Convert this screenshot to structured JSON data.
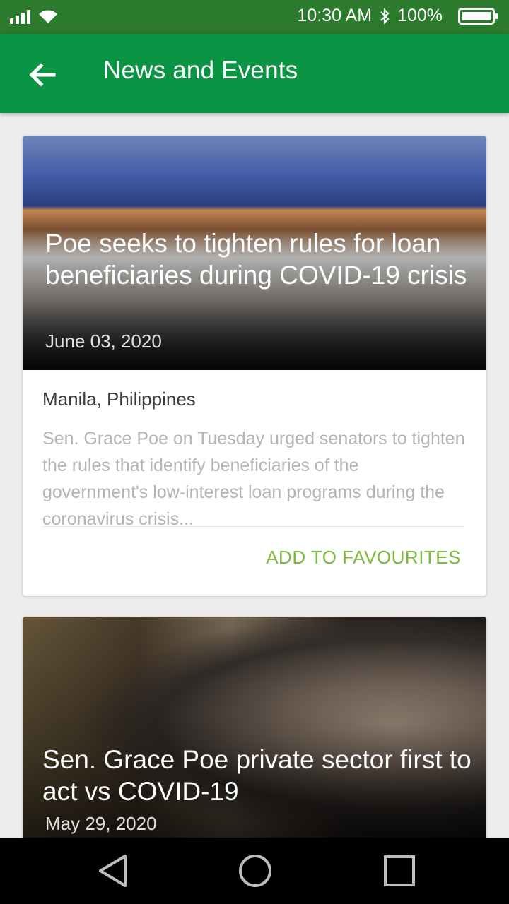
{
  "status_bar": {
    "time": "10:30 AM",
    "battery": "100%",
    "battery_level": 1.0,
    "icons": [
      "signal-icon",
      "wifi-icon",
      "bluetooth-icon",
      "battery-icon"
    ]
  },
  "app_bar": {
    "title": "News and Events",
    "back_icon": "arrow-left-icon",
    "background": "#0b9444"
  },
  "articles": [
    {
      "title": "Poe seeks to tighten rules for loan beneficiaries during COVID-19 crisis",
      "date": "June 03, 2020",
      "location": "Manila, Philippines",
      "excerpt": "Sen. Grace Poe on Tuesday urged senators to tighten the rules that identify beneficiaries of the government's low-interest loan programs during the coronavirus crisis...",
      "action": "ADD TO  FAVOURITES"
    },
    {
      "title": "Sen. Grace Poe private sector first to act vs COVID-19",
      "date": "May 29, 2020"
    }
  ],
  "colors": {
    "accent": "#7cb83c",
    "status_bar": "#2c7a2c"
  },
  "nav_bar": {
    "icons": [
      "triangle-back-icon",
      "circle-home-icon",
      "square-recents-icon"
    ]
  }
}
